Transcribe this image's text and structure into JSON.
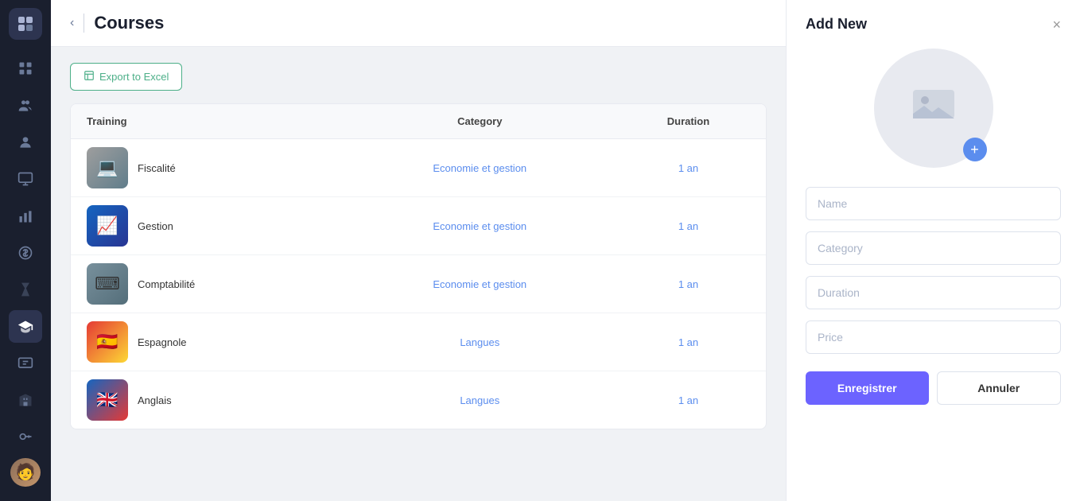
{
  "sidebar": {
    "logo_icon": "🏛",
    "items": [
      {
        "id": "dashboard",
        "icon": "⊞",
        "label": "Dashboard",
        "active": false
      },
      {
        "id": "users-group",
        "icon": "👥",
        "label": "Users Group",
        "active": false
      },
      {
        "id": "users",
        "icon": "👤",
        "label": "Users",
        "active": false
      },
      {
        "id": "screen",
        "icon": "🖥",
        "label": "Screen",
        "active": false
      },
      {
        "id": "chart",
        "icon": "📊",
        "label": "Chart",
        "active": false
      },
      {
        "id": "billing",
        "icon": "💲",
        "label": "Billing",
        "active": false
      },
      {
        "id": "hourglass",
        "icon": "⏳",
        "label": "Hourglass",
        "active": false
      },
      {
        "id": "courses",
        "icon": "🎓",
        "label": "Courses",
        "active": true
      },
      {
        "id": "certificate",
        "icon": "📜",
        "label": "Certificate",
        "active": false
      },
      {
        "id": "building",
        "icon": "🏢",
        "label": "Building",
        "active": false
      },
      {
        "id": "key",
        "icon": "🔑",
        "label": "Key",
        "active": false
      }
    ],
    "avatar_emoji": "🧑"
  },
  "header": {
    "back_label": "‹",
    "divider": true,
    "title": "Courses"
  },
  "toolbar": {
    "export_icon": "📊",
    "export_label": "Export to Excel"
  },
  "table": {
    "columns": [
      {
        "id": "training",
        "label": "Training"
      },
      {
        "id": "category",
        "label": "Category"
      },
      {
        "id": "duration",
        "label": "Duration"
      }
    ],
    "rows": [
      {
        "id": 1,
        "name": "Fiscalité",
        "category": "Economie et gestion",
        "duration": "1 an",
        "thumb_class": "thumb-fiscalite",
        "thumb_icon": "💻"
      },
      {
        "id": 2,
        "name": "Gestion",
        "category": "Economie et gestion",
        "duration": "1 an",
        "thumb_class": "thumb-gestion",
        "thumb_icon": "📈"
      },
      {
        "id": 3,
        "name": "Comptabilité",
        "category": "Economie et gestion",
        "duration": "1 an",
        "thumb_class": "thumb-comptabilite",
        "thumb_icon": "⌨"
      },
      {
        "id": 4,
        "name": "Espagnole",
        "category": "Langues",
        "duration": "1 an",
        "thumb_class": "thumb-espagnole",
        "thumb_icon": "🇪🇸"
      },
      {
        "id": 5,
        "name": "Anglais",
        "category": "Langues",
        "duration": "1 an",
        "thumb_class": "thumb-anglais",
        "thumb_icon": "🇬🇧"
      }
    ]
  },
  "panel": {
    "title": "Add New",
    "close_label": "×",
    "fields": {
      "name_placeholder": "Name",
      "category_placeholder": "Category",
      "duration_placeholder": "Duration",
      "price_placeholder": "Price"
    },
    "buttons": {
      "save_label": "Enregistrer",
      "cancel_label": "Annuler"
    }
  }
}
